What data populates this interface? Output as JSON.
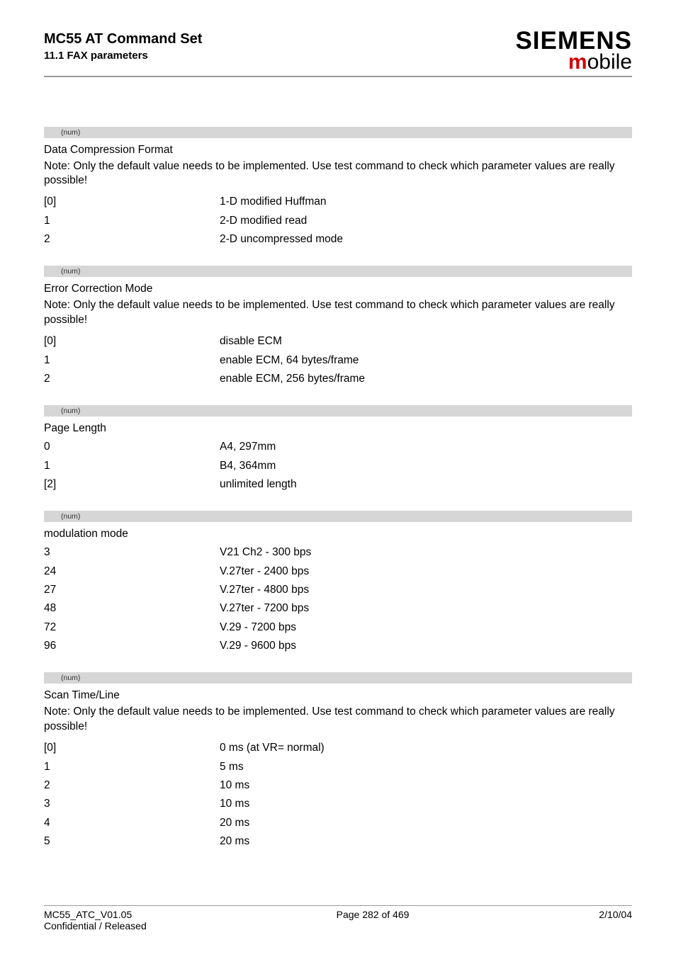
{
  "header": {
    "title": "MC55 AT Command Set",
    "subtitle": "11.1 FAX parameters",
    "brand_main": "SIEMENS",
    "brand_sub_m": "m",
    "brand_sub_rest": "obile"
  },
  "sections": [
    {
      "bar": "(num)",
      "title": "Data Compression Format",
      "note": "Note: Only the default value needs to be implemented. Use test command to check which parameter values are really possible!",
      "rows": [
        {
          "k": "[0]",
          "v": "1-D modified Huffman"
        },
        {
          "k": "1",
          "v": "2-D modified read"
        },
        {
          "k": "2",
          "v": "2-D uncompressed mode"
        }
      ]
    },
    {
      "bar": "(num)",
      "title": "Error Correction Mode",
      "note": "Note: Only the default value needs to be implemented. Use test command to check which parameter values are really possible!",
      "rows": [
        {
          "k": "[0]",
          "v": "disable ECM"
        },
        {
          "k": "1",
          "v": "enable ECM, 64 bytes/frame"
        },
        {
          "k": "2",
          "v": "enable ECM, 256 bytes/frame"
        }
      ]
    },
    {
      "bar": "(num)",
      "title": "Page Length",
      "note": "",
      "rows": [
        {
          "k": "0",
          "v": "A4, 297mm"
        },
        {
          "k": "1",
          "v": "B4, 364mm"
        },
        {
          "k": "[2]",
          "v": "unlimited length"
        }
      ]
    },
    {
      "bar": "(num)",
      "title": "modulation mode",
      "note": "",
      "rows": [
        {
          "k": "3",
          "v": "V21 Ch2 - 300 bps"
        },
        {
          "k": "24",
          "v": "V.27ter - 2400 bps"
        },
        {
          "k": "27",
          "v": "V.27ter - 4800 bps"
        },
        {
          "k": "48",
          "v": "V.27ter - 7200 bps"
        },
        {
          "k": "72",
          "v": "V.29 - 7200 bps"
        },
        {
          "k": "96",
          "v": "V.29 - 9600 bps"
        }
      ]
    },
    {
      "bar": "(num)",
      "title": "Scan Time/Line",
      "note": "Note: Only the default value needs to be implemented. Use test command to check which parameter values are really possible!",
      "rows": [
        {
          "k": "[0]",
          "v": "0 ms (at VR= normal)"
        },
        {
          "k": "1",
          "v": "5 ms"
        },
        {
          "k": "2",
          "v": "10 ms"
        },
        {
          "k": "3",
          "v": "10 ms"
        },
        {
          "k": "4",
          "v": "20 ms"
        },
        {
          "k": "5",
          "v": "20 ms"
        }
      ]
    }
  ],
  "footer": {
    "left1": "MC55_ATC_V01.05",
    "left2": "Confidential / Released",
    "center": "Page 282 of 469",
    "right": "2/10/04"
  }
}
